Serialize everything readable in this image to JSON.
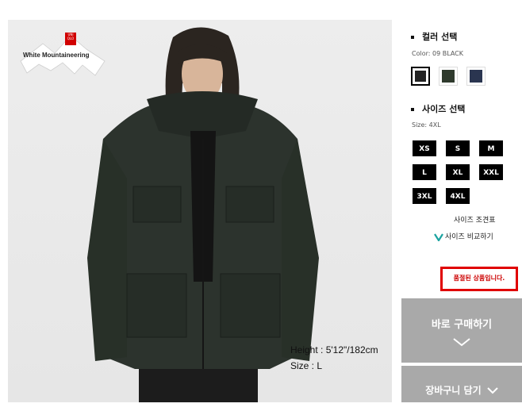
{
  "product_image": {
    "brand_logo_mark": "UNI QLO",
    "brand_collab": "White Mountaineering",
    "model_height": "Height : 5'12\"/182cm",
    "model_size": "Size : L"
  },
  "color_section": {
    "title": "컬러 선택",
    "selected_label": "Color: 09 BLACK",
    "swatches": [
      {
        "name": "black",
        "color": "#222222",
        "selected": true
      },
      {
        "name": "olive",
        "color": "#2f3a2d",
        "selected": false
      },
      {
        "name": "navy",
        "color": "#2a3550",
        "selected": false
      }
    ]
  },
  "size_section": {
    "title": "사이즈 선택",
    "selected_label": "Size: 4XL",
    "sizes": [
      "XS",
      "S",
      "M",
      "L",
      "XL",
      "XXL",
      "3XL",
      "4XL"
    ],
    "size_chart_link": "사이즈 조견표",
    "size_compare_link": "사이즈 비교하기"
  },
  "status": {
    "sold_out": "품절된 상품입니다."
  },
  "actions": {
    "buy_now": "바로 구매하기",
    "add_to_cart": "장바구니 담기"
  }
}
